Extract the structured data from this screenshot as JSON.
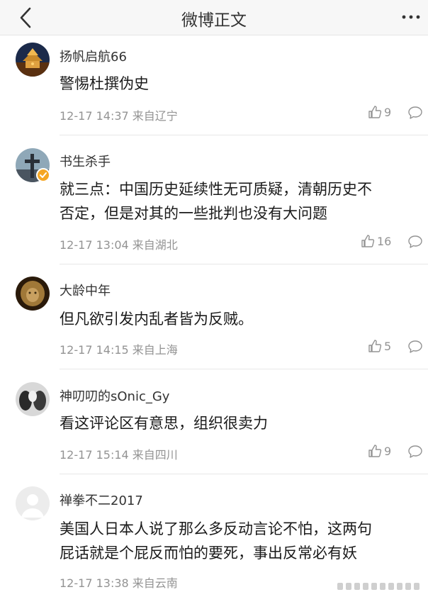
{
  "header": {
    "title": "微博正文"
  },
  "comments": [
    {
      "user": "扬帆启航66",
      "text_lines": [
        "警惕杜撰伪史"
      ],
      "time": "12-17 14:37",
      "location": "来自辽宁",
      "likes": "9",
      "avatar_icon": "night-temple-avatar"
    },
    {
      "user": "书生杀手",
      "text_lines": [
        "就三点：中国历史延续性无可质疑，清朝历史不",
        "否定，但是对其的一些批判也没有大问题"
      ],
      "time": "12-17 13:04",
      "location": "来自湖北",
      "likes": "16",
      "avatar_icon": "cross-avatar",
      "verified": true
    },
    {
      "user": "大龄中年",
      "text_lines": [
        "但凡欲引发内乱者皆为反贼。"
      ],
      "time": "12-17 14:15",
      "location": "来自上海",
      "likes": "5",
      "avatar_icon": "lion-avatar"
    },
    {
      "user": "神叨叨的sOnic_Gy",
      "text_lines": [
        "看这评论区有意思，组织很卖力"
      ],
      "time": "12-17 15:14",
      "location": "来自四川",
      "likes": "9",
      "avatar_icon": "figures-avatar"
    },
    {
      "user": "禅拳不二2017",
      "text_lines": [
        "美国人日本人说了那么多反动言论不怕，这两句",
        "屁话就是个屁反而怕的要死，事出反常必有妖"
      ],
      "time": "12-17 13:38",
      "location": "来自云南",
      "likes": "",
      "avatar_icon": "default-avatar"
    }
  ],
  "colors": {
    "meta": "#939393",
    "verified": "#f5a623"
  }
}
